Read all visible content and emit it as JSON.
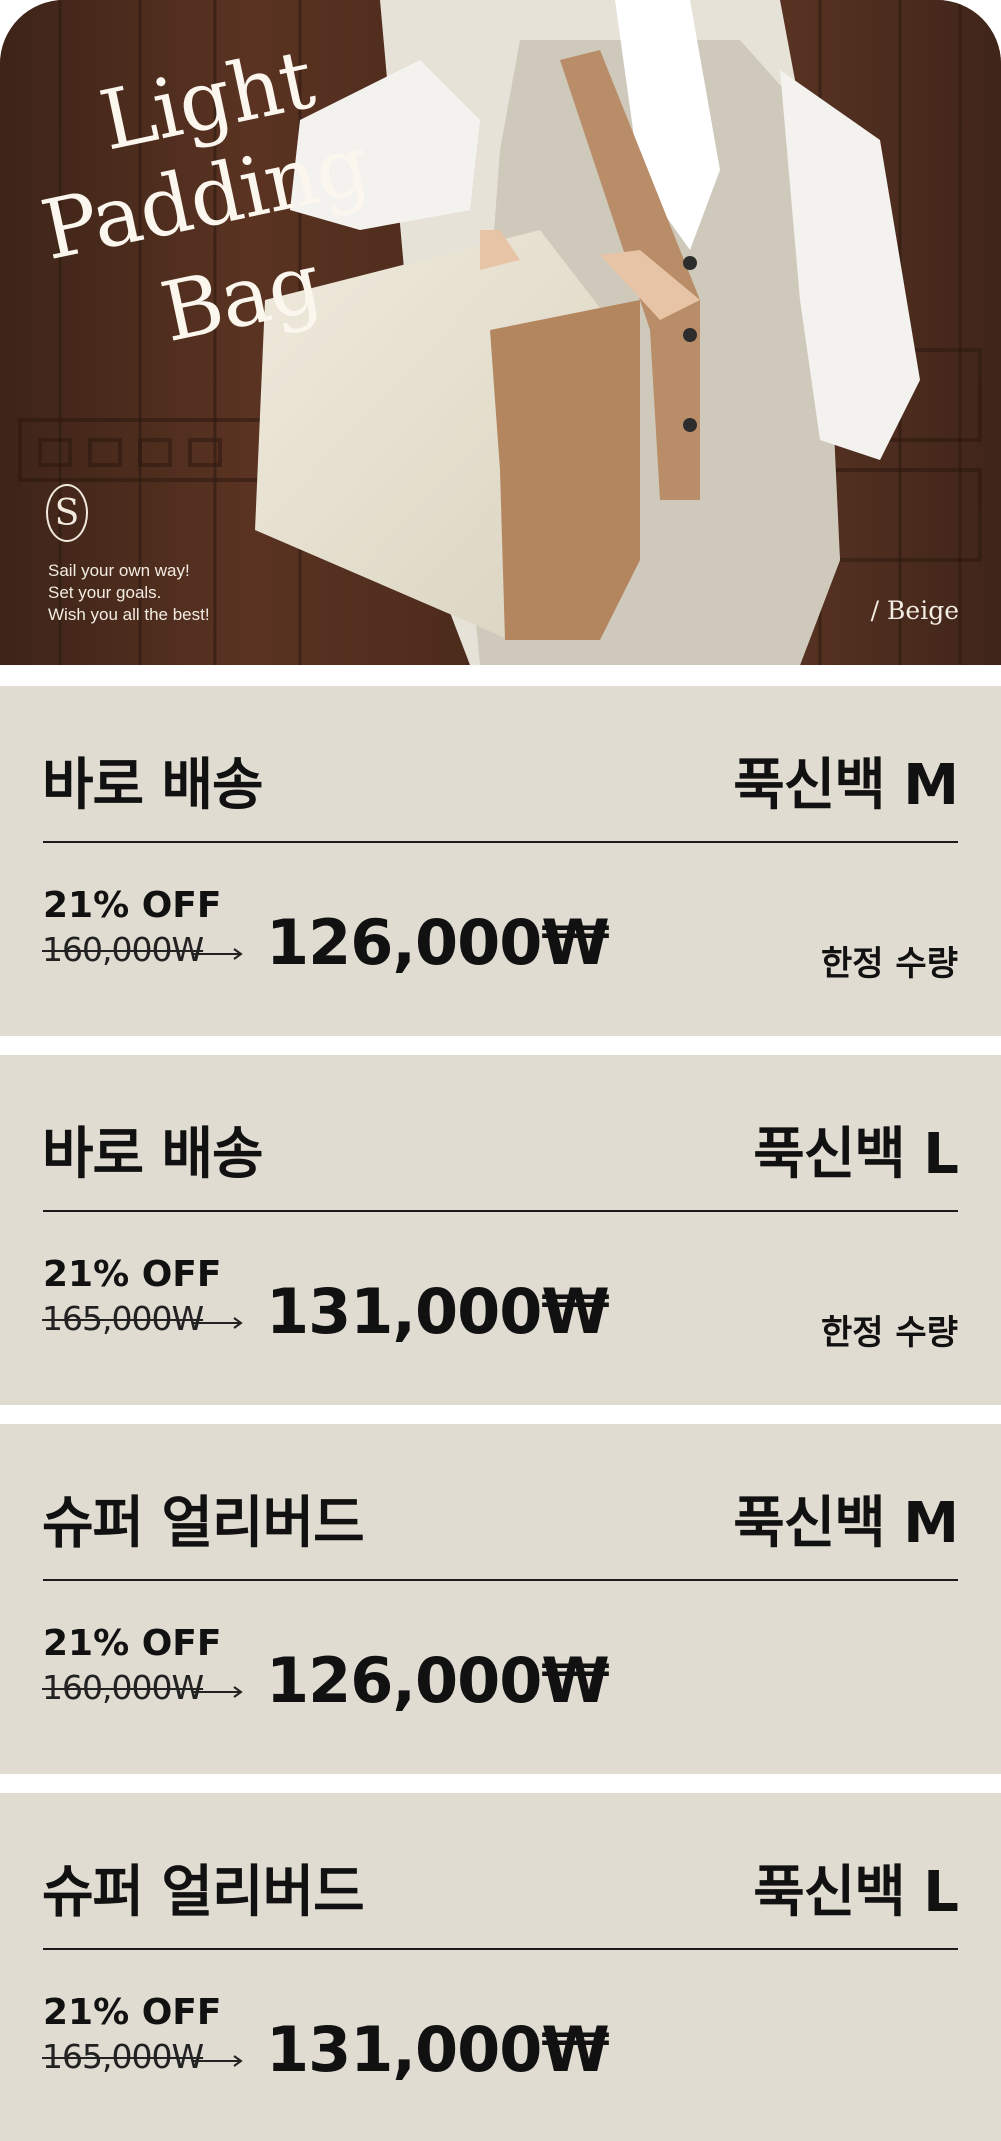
{
  "hero": {
    "title_lines": [
      "Light",
      "Padding",
      "Bag"
    ],
    "logo_glyph": "S",
    "tagline": [
      "Sail your own way!",
      "Set your goals.",
      "Wish you all the best!"
    ],
    "color_label": "/  Beige"
  },
  "cards": [
    {
      "shipping": "바로 배송",
      "product": "푹신백 M",
      "discount": "21% OFF",
      "original_price": "160,000W",
      "sale_price": "126,000₩",
      "limited": "한정 수량"
    },
    {
      "shipping": "바로 배송",
      "product": "푹신백 L",
      "discount": "21% OFF",
      "original_price": "165,000W",
      "sale_price": "131,000₩",
      "limited": "한정 수량"
    },
    {
      "shipping": "슈퍼 얼리버드",
      "product": "푹신백 M",
      "discount": "21% OFF",
      "original_price": "160,000W",
      "sale_price": "126,000₩"
    },
    {
      "shipping": "슈퍼 얼리버드",
      "product": "푹신백 L",
      "discount": "21% OFF",
      "original_price": "165,000W",
      "sale_price": "131,000₩"
    }
  ]
}
